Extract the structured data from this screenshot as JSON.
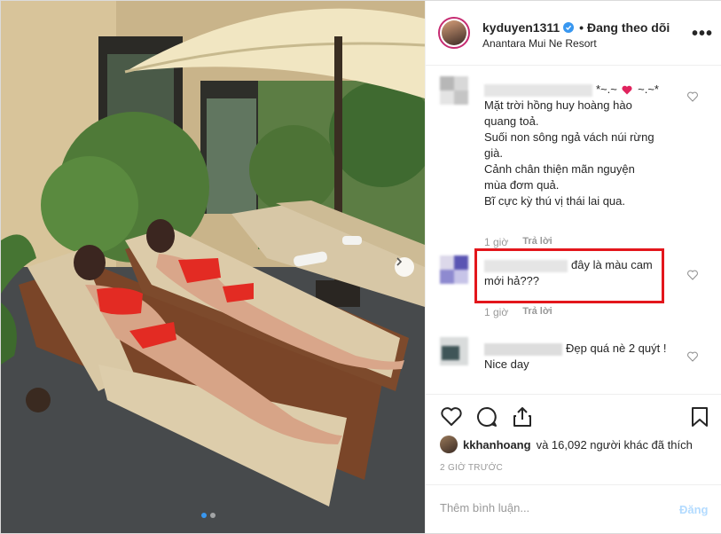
{
  "post": {
    "username": "kyduyen1311",
    "follow_status": "• Đang theo dõi",
    "location": "Anantara Mui Ne Resort",
    "more_icon": "more-options-icon"
  },
  "comments": [
    {
      "name_suffix": "*~.~",
      "name_suffix2": "~.~*",
      "lines": [
        "Mặt trời hồng huy hoàng hào",
        "quang toả.",
        "Suối non sông ngả vách núi rừng",
        "già.",
        "Cảnh chân thiện mãn nguyện",
        "mùa đơm quả.",
        "Bĩ cực kỳ thú vị thái lai qua."
      ],
      "time": "1 giờ",
      "reply": "Trả lời"
    },
    {
      "lines": [
        "đây là màu cam",
        "mới hả???"
      ],
      "time": "1 giờ",
      "reply": "Trả lời"
    },
    {
      "lines": [
        "Đẹp quá nè 2 quýt !",
        "Nice day"
      ],
      "blurred_name": "dalat102025"
    }
  ],
  "likes": {
    "first_user": "kkhanhoang",
    "rest": "và 16,092 người khác đã thích"
  },
  "timestamp": "2 GIỜ TRƯỚC",
  "comment_box": {
    "placeholder": "Thêm bình luận...",
    "post_label": "Đăng"
  },
  "colors": {
    "highlight": "#e3161c",
    "verified": "#3897f0",
    "post_disabled": "#b3dbff"
  }
}
